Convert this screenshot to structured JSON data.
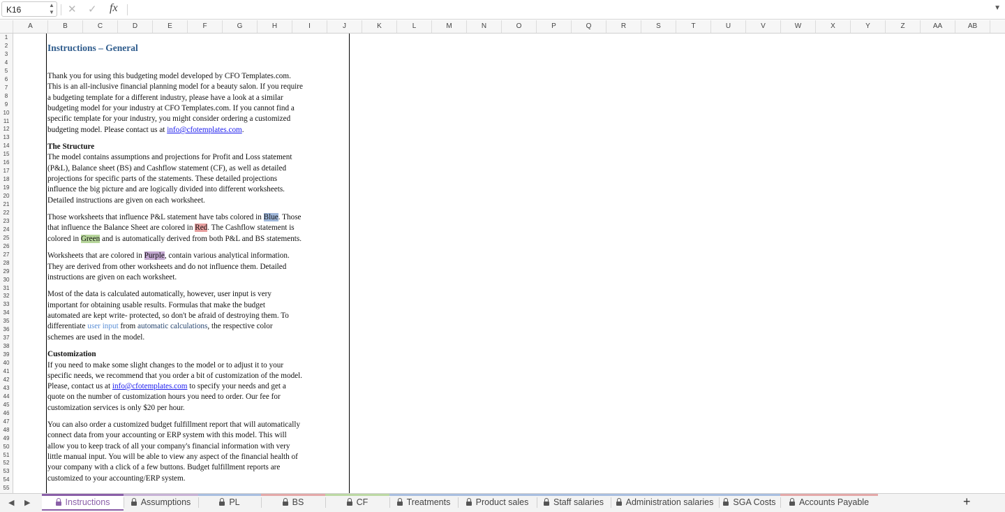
{
  "formula_bar": {
    "cell_ref": "K16",
    "cancel_icon": "x-icon",
    "confirm_icon": "check-icon",
    "fx_label": "fx",
    "formula": ""
  },
  "columns": [
    "A",
    "B",
    "C",
    "D",
    "E",
    "F",
    "G",
    "H",
    "I",
    "J",
    "K",
    "L",
    "M",
    "N",
    "O",
    "P",
    "Q",
    "R",
    "S",
    "T",
    "U",
    "V",
    "W",
    "X",
    "Y",
    "Z",
    "AA",
    "AB"
  ],
  "rows": [
    "1",
    "2",
    "3",
    "4",
    "5",
    "6",
    "7",
    "8",
    "9",
    "10",
    "11",
    "12",
    "13",
    "14",
    "15",
    "16",
    "17",
    "18",
    "19",
    "20",
    "21",
    "22",
    "23",
    "24",
    "25",
    "26",
    "27",
    "28",
    "29",
    "30",
    "31",
    "32",
    "33",
    "34",
    "35",
    "36",
    "37",
    "38",
    "39",
    "40",
    "41",
    "42",
    "43",
    "44",
    "45",
    "46",
    "47",
    "48",
    "49",
    "50",
    "51",
    "52",
    "53",
    "54",
    "55"
  ],
  "content": {
    "title": "Instructions – General",
    "p1": [
      "Thank you for using this budgeting model developed by CFO Templates.com.",
      "This is an all-inclusive financial planning model for a beauty salon. If you require",
      "a budgeting template for a different industry, please have a look at a similar",
      "budgeting model for your industry at CFO Templates.com. If you cannot find a",
      "specific template for your industry, you might consider ordering a customized"
    ],
    "p1_last_pre": "budgeting model. Please contact us at ",
    "email": "info@cfotemplates.com",
    "p1_last_post": ".",
    "h_structure": "The Structure",
    "p2": [
      "The model contains assumptions and projections for Profit and Loss statement",
      "(P&L), Balance sheet (BS) and Cashflow statement (CF), as well as detailed",
      "projections for specific parts of the statements. These detailed projections",
      "influence the big picture and are logically divided into different worksheets.",
      "Detailed instructions are given on each worksheet."
    ],
    "p3a_pre": "Those worksheets that influence P&L statement have tabs colored in ",
    "blue": "Blue",
    "p3a_post": ". Those",
    "p3b_pre": "that influence the Balance Sheet are colored in ",
    "red": "Red",
    "p3b_post": ". The Cashflow statement is",
    "p3c_pre": "colored in ",
    "green": "Green",
    "p3c_post": " and is automatically derived from both P&L and BS statements.",
    "p4a_pre": "Worksheets that are colored in ",
    "purple": "Purple",
    "p4a_post": ", contain various analytical information.",
    "p4": [
      "They are derived from other worksheets and do not influence them. Detailed",
      "instructions are given on each worksheet."
    ],
    "p5": [
      "Most of the data is calculated automatically, however, user input is very",
      "important for obtaining usable results. Formulas that make the budget",
      "automated are kept write- protected, so don't be afraid of destroying them. To"
    ],
    "p5d_pre": "differentiate ",
    "user_input": "user input",
    "p5d_mid": " from ",
    "auto_calc": "automatic calculations",
    "p5d_post": ", the respective color",
    "p5e": "schemes are used in the model.",
    "h_custom": "Customization",
    "p6": [
      "If you need to make some slight changes to the model or to adjust it to your",
      "specific needs, we recommend that you order a bit of customization of the model."
    ],
    "p6c_pre": "Please, contact us at ",
    "p6c_post": " to specify your needs and get a",
    "p6d": [
      "quote on the number of customization hours you need to order. Our fee for",
      "customization services is only $20 per hour."
    ],
    "p7": [
      "You can also order a customized budget fulfillment report that will automatically",
      "connect data from your accounting or ERP system with this model. This will",
      "allow you to keep track of all your company's financial information with very",
      "little manual input. You will be able to view any aspect of the financial health of",
      "your company with a click of a few buttons. Budget fulfillment reports are",
      "customized to your accounting/ERP system."
    ]
  },
  "tabs": [
    {
      "label": "Instructions",
      "color": "#8a5fa8"
    },
    {
      "label": "Assumptions",
      "color": "#c7b3d6"
    },
    {
      "label": "PL",
      "color": "#a9bfe0"
    },
    {
      "label": "BS",
      "color": "#e4a9a9"
    },
    {
      "label": "CF",
      "color": "#bcd9a4"
    },
    {
      "label": "Treatments",
      "color": "#a9bfe0"
    },
    {
      "label": "Product sales",
      "color": "#a9bfe0"
    },
    {
      "label": "Staff salaries",
      "color": "#a9bfe0"
    },
    {
      "label": "Administration salaries",
      "color": "#a9bfe0"
    },
    {
      "label": "SGA Costs",
      "color": "#a9bfe0"
    },
    {
      "label": "Accounts Payable",
      "color": "#e4a9a9"
    }
  ],
  "add_sheet": "+"
}
